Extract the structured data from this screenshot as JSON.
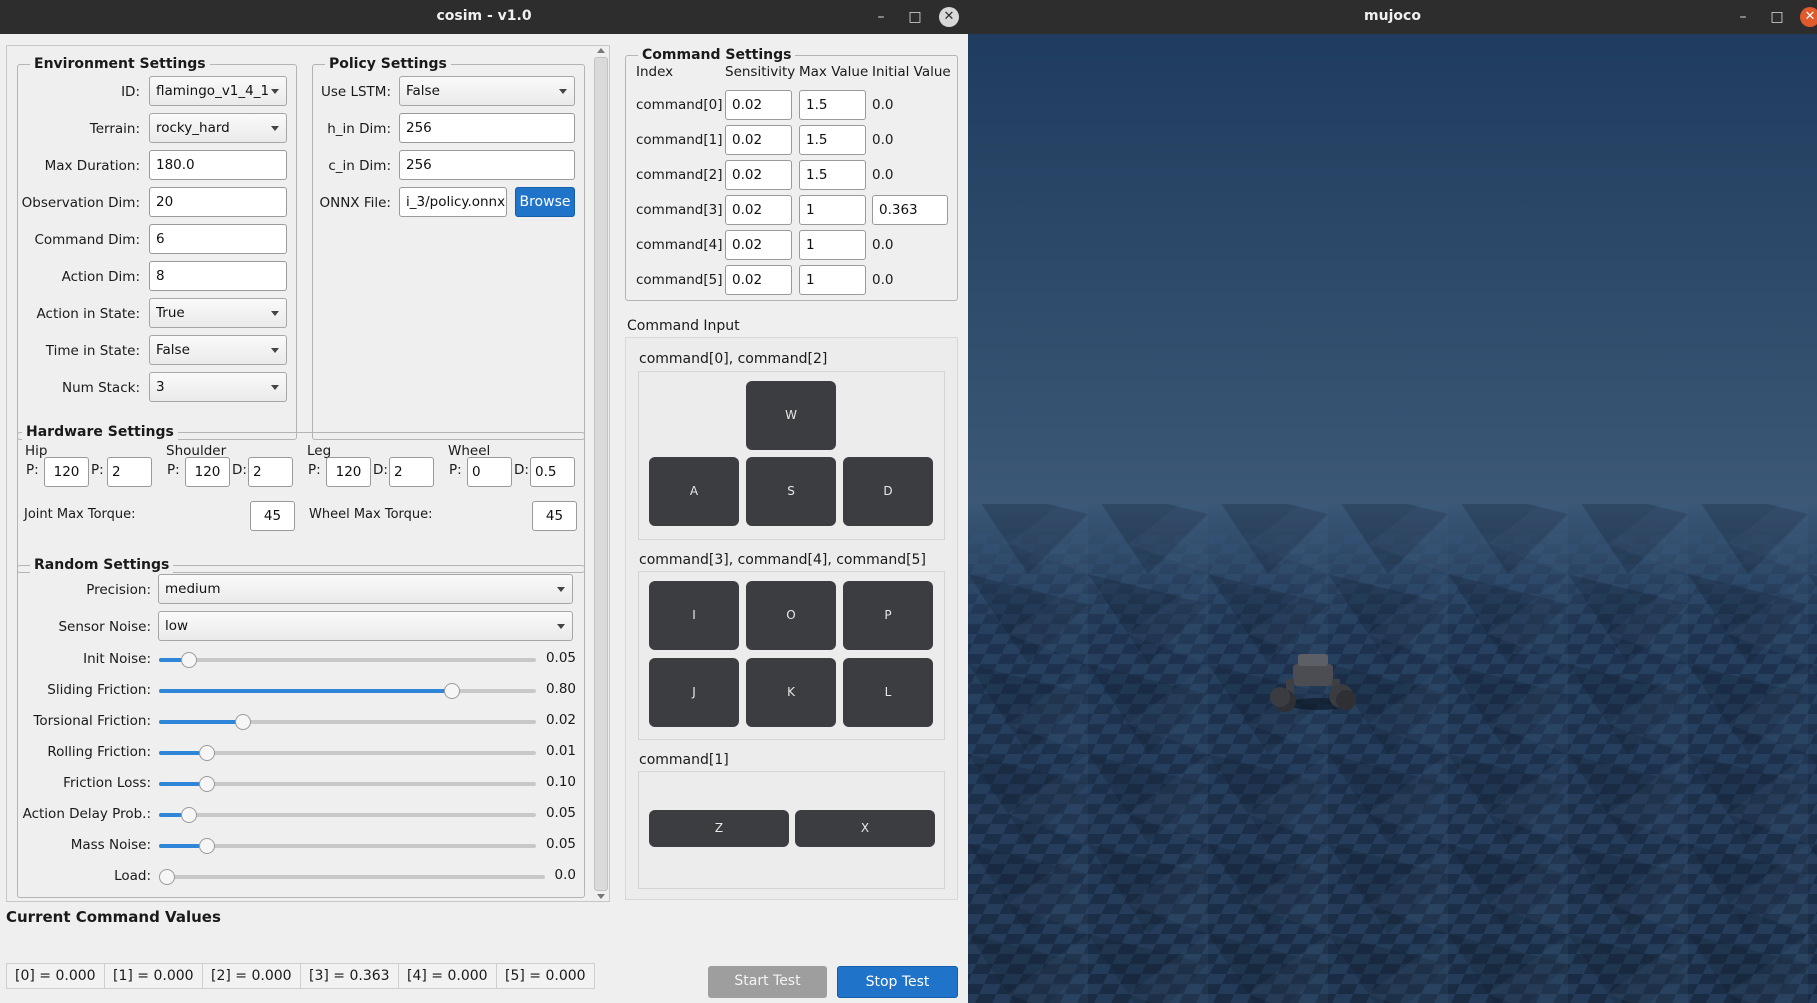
{
  "cosim": {
    "title": "cosim  -  v1.0",
    "env": {
      "title": "Environment Settings",
      "rows": [
        {
          "label": "ID:",
          "value": "flamingo_v1_4_1",
          "kind": "combo"
        },
        {
          "label": "Terrain:",
          "value": "rocky_hard",
          "kind": "combo"
        },
        {
          "label": "Max Duration:",
          "value": "180.0",
          "kind": "input"
        },
        {
          "label": "Observation Dim:",
          "value": "20",
          "kind": "input"
        },
        {
          "label": "Command Dim:",
          "value": "6",
          "kind": "input"
        },
        {
          "label": "Action Dim:",
          "value": "8",
          "kind": "input"
        },
        {
          "label": "Action in State:",
          "value": "True",
          "kind": "combo"
        },
        {
          "label": "Time in State:",
          "value": "False",
          "kind": "combo"
        },
        {
          "label": "Num Stack:",
          "value": "3",
          "kind": "combo"
        }
      ]
    },
    "policy": {
      "title": "Policy Settings",
      "use_lstm_label": "Use LSTM:",
      "use_lstm": "False",
      "h_label": "h_in Dim:",
      "h_value": "256",
      "c_label": "c_in Dim:",
      "c_value": "256",
      "onnx_label": "ONNX File:",
      "onnx_value": "i_3/policy.onnx",
      "browse": "Browse"
    },
    "hardware": {
      "title": "Hardware Settings",
      "groups": [
        {
          "name": "Hip",
          "p": "120",
          "d": "2"
        },
        {
          "name": "Shoulder",
          "p": "120",
          "d": "2"
        },
        {
          "name": "Leg",
          "p": "120",
          "d": "2"
        },
        {
          "name": "Wheel",
          "p": "0",
          "d": "0.5"
        }
      ],
      "p_label": "P:",
      "d_label": "D:",
      "joint_label": "Joint Max Torque:",
      "joint_value": "45",
      "wheel_label": "Wheel Max Torque:",
      "wheel_value": "45"
    },
    "random": {
      "title": "Random Settings",
      "precision_label": "Precision:",
      "precision": "medium",
      "noise_label": "Sensor Noise:",
      "noise": "low",
      "sliders": [
        {
          "label": "Init Noise:",
          "value": "0.05",
          "level": 0.06
        },
        {
          "label": "Sliding Friction:",
          "value": "0.80",
          "level": 0.79
        },
        {
          "label": "Torsional Friction:",
          "value": "0.02",
          "level": 0.21
        },
        {
          "label": "Rolling Friction:",
          "value": "0.01",
          "level": 0.11
        },
        {
          "label": "Friction Loss:",
          "value": "0.10",
          "level": 0.11
        },
        {
          "label": "Action Delay Prob.:",
          "value": "0.05",
          "level": 0.06
        },
        {
          "label": "Mass Noise:",
          "value": "0.05",
          "level": 0.11
        },
        {
          "label": "Load:",
          "value": "0.0",
          "level": 0.0
        }
      ]
    },
    "command_settings": {
      "title": "Command Settings",
      "headers": [
        "Index",
        "Sensitivity",
        "Max Value",
        "Initial Value"
      ],
      "rows": [
        {
          "index": "command[0]",
          "sens": "0.02",
          "max": "1.5",
          "init": "0.0",
          "init_editable": false
        },
        {
          "index": "command[1]",
          "sens": "0.02",
          "max": "1.5",
          "init": "0.0",
          "init_editable": false
        },
        {
          "index": "command[2]",
          "sens": "0.02",
          "max": "1.5",
          "init": "0.0",
          "init_editable": false
        },
        {
          "index": "command[3]",
          "sens": "0.02",
          "max": "1",
          "init": "0.363",
          "init_editable": true
        },
        {
          "index": "command[4]",
          "sens": "0.02",
          "max": "1",
          "init": "0.0",
          "init_editable": false
        },
        {
          "index": "command[5]",
          "sens": "0.02",
          "max": "1",
          "init": "0.0",
          "init_editable": false
        }
      ]
    },
    "command_input": {
      "title": "Command Input",
      "group1_label": "command[0], command[2]",
      "keys1": [
        "W",
        "A",
        "S",
        "D"
      ],
      "group2_label": "command[3], command[4], command[5]",
      "keys2": [
        "I",
        "O",
        "P",
        "J",
        "K",
        "L"
      ],
      "group3_label": "command[1]",
      "keys3": [
        "Z",
        "X"
      ]
    },
    "current": {
      "title": "Current Command Values",
      "values": [
        "[0] = 0.000",
        "[1] = 0.000",
        "[2] = 0.000",
        "[3] = 0.363",
        "[4] = 0.000",
        "[5] = 0.000"
      ]
    },
    "start_test": "Start Test",
    "stop_test": "Stop Test"
  },
  "mujoco": {
    "title": "mujoco"
  },
  "colors": {
    "accent": "#1f73c8",
    "titlebar": "#2d2d2d",
    "close": "#e05a2b",
    "sky": "#2e4a6a",
    "floor": "#1d2f45"
  },
  "icons": [
    "minimize-icon",
    "maximize-icon",
    "close-icon",
    "dropdown-arrow-icon"
  ]
}
